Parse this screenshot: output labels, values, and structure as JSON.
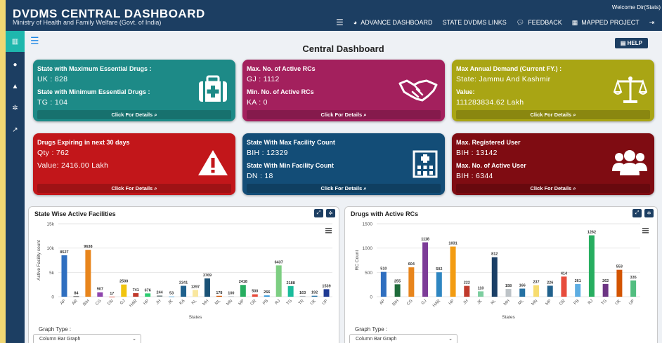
{
  "header": {
    "title": "DVDMS CENTRAL DASHBOARD",
    "subtitle": "Ministry of Health and Family Welfare (Govt. of India)",
    "welcome": "Welcome Dir(Stats)",
    "nav": [
      {
        "label": "ADVANCE DASHBOARD",
        "icon": "pie-icon"
      },
      {
        "label": "STATE DVDMS LINKS",
        "icon": ""
      },
      {
        "label": "FEEDBACK",
        "icon": "comment-icon"
      },
      {
        "label": "MAPPED PROJECT",
        "icon": "calendar-icon"
      }
    ]
  },
  "main": {
    "title": "Central Dashboard",
    "help_label": "HELP"
  },
  "cards": [
    {
      "color": "#1d8a87",
      "l1": "State with Maximum Essential Drugs :",
      "v1": "UK : 828",
      "l2": "State with Minimum Essential Drugs :",
      "v2": "TG : 104",
      "footer": "Click For Details",
      "icon": "medical-kit-icon"
    },
    {
      "color": "#a3205d",
      "l1": "Max. No. of Active RCs",
      "v1": "GJ : 1112",
      "l2": "Min. No. of Active RCs",
      "v2": "KA : 0",
      "footer": "Click For Details",
      "icon": "handshake-icon"
    },
    {
      "color": "#a9a514",
      "l1": "Max Annual Demand (Current FY.) :",
      "v1": "State: Jammu And Kashmir",
      "l2": "Value:",
      "v2": "111283834.62 Lakh",
      "footer": "Click For Details",
      "icon": "balance-scale-icon"
    },
    {
      "color": "#c2161a",
      "l1": "Drugs Expiring in next 30 days",
      "v1": "Qty : 762",
      "l2": "",
      "v2": "Value: 2416.00 Lakh",
      "footer": "Click For Details",
      "icon": "warning-icon"
    },
    {
      "color": "#134d77",
      "l1": "State With Max Facility Count",
      "v1": "BIH : 12329",
      "l2": "State With Min Facility Count",
      "v2": "DN : 18",
      "footer": "Click For Details",
      "icon": "hospital-icon"
    },
    {
      "color": "#7f0c12",
      "l1": "Max. Registered User",
      "v1": "BIH : 13142",
      "l2": "Max. No. of Active User",
      "v2": "BIH : 6344",
      "footer": "Click For Details",
      "icon": "users-icon"
    }
  ],
  "panels": [
    {
      "title": "State Wise Active Facilities",
      "graph_type_label": "Graph Type :",
      "graph_type_value": "Column Bar Graph"
    },
    {
      "title": "Drugs with Active RCs",
      "graph_type_label": "Graph Type :",
      "graph_type_value": "Column Bar Graph"
    }
  ],
  "chart_data": [
    {
      "type": "bar",
      "xlabel": "States",
      "ylabel": "Active Facility count",
      "ylim": [
        0,
        15000
      ],
      "yticks": [
        "0",
        "5k",
        "10k",
        "15k"
      ],
      "categories": [
        "AP",
        "AR",
        "BIH",
        "CG",
        "DN",
        "GJ",
        "HAR",
        "HP",
        "JH",
        "JK",
        "KA",
        "KL",
        "MH",
        "ML",
        "MN",
        "MP",
        "OR",
        "PB",
        "RJ",
        "TG",
        "TR",
        "UK",
        "UP"
      ],
      "values": [
        8527,
        84,
        9638,
        907,
        17,
        2500,
        741,
        676,
        244,
        53,
        2241,
        1397,
        3769,
        178,
        100,
        2418,
        500,
        266,
        6437,
        2188,
        163,
        192,
        1539
      ],
      "colors": [
        "#2f6fc0",
        "#3a3a3a",
        "#e8851c",
        "#8e44ad",
        "#e74c3c",
        "#f1c40f",
        "#c0392b",
        "#2ecc71",
        "#7f8c8d",
        "#5dade2",
        "#1f618d",
        "#f9e79f",
        "#1a5276",
        "#d35400",
        "#bdc3c7",
        "#27ae60",
        "#e74c3c",
        "#3498db",
        "#7dce82",
        "#1abc9c",
        "#abb2b9",
        "#2874a6",
        "#1f3a93"
      ],
      "grid": true
    },
    {
      "type": "bar",
      "xlabel": "States",
      "ylabel": "RC Count",
      "ylim": [
        0,
        1500
      ],
      "yticks": [
        "0",
        "500",
        "1000",
        "1500"
      ],
      "categories": [
        "AP",
        "BIH",
        "CG",
        "GJ",
        "HAR",
        "HP",
        "JH",
        "JK",
        "KL",
        "MH",
        "ML",
        "MN",
        "MP",
        "OR",
        "PB",
        "RJ",
        "TG",
        "UK",
        "UP"
      ],
      "values": [
        510,
        255,
        604,
        1118,
        502,
        1031,
        222,
        110,
        812,
        158,
        166,
        237,
        226,
        414,
        261,
        1262,
        262,
        553,
        335
      ],
      "colors": [
        "#2f6fc0",
        "#1e6b3a",
        "#e8851c",
        "#7d3c98",
        "#2e86c1",
        "#f39c12",
        "#c0392b",
        "#7dcea0",
        "#1a3f66",
        "#bdc3c7",
        "#2471a3",
        "#f7dc6f",
        "#21618c",
        "#e74c3c",
        "#5dade2",
        "#27ae60",
        "#6c3483",
        "#d35400",
        "#52be80"
      ],
      "grid": true
    }
  ]
}
